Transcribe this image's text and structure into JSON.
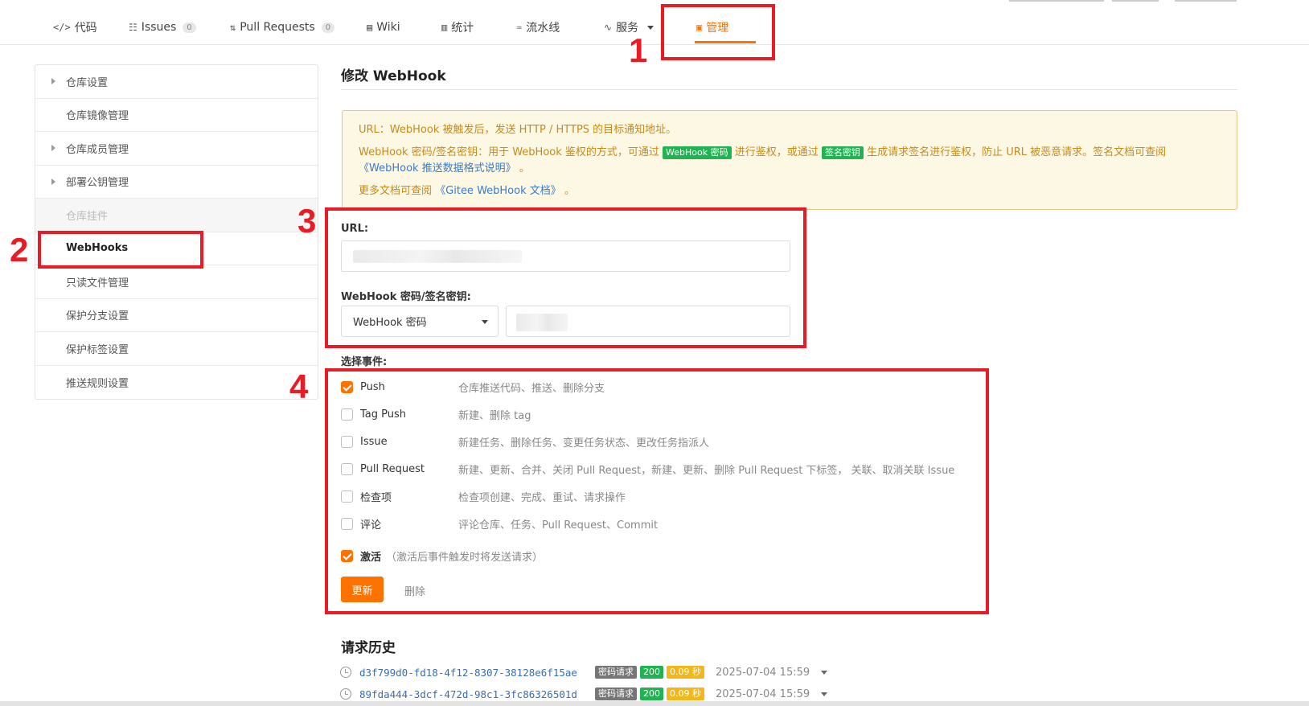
{
  "tabs": [
    {
      "icon": "</>",
      "label": "代码",
      "count": ""
    },
    {
      "icon": "☷",
      "label": "Issues",
      "count": "0"
    },
    {
      "icon": "⇅",
      "label": "Pull Requests",
      "count": "0"
    },
    {
      "icon": "▤",
      "label": "Wiki",
      "count": ""
    },
    {
      "icon": "▥",
      "label": "统计",
      "count": ""
    },
    {
      "icon": "♒",
      "label": "流水线",
      "count": ""
    },
    {
      "icon": "∿",
      "label": "服务",
      "count": ""
    },
    {
      "icon": "▣",
      "label": "管理",
      "count": ""
    }
  ],
  "sidebar": {
    "items": [
      {
        "label": "仓库设置"
      },
      {
        "label": "仓库镜像管理"
      },
      {
        "label": "仓库成员管理"
      },
      {
        "label": "部署公钥管理"
      },
      {
        "label": "仓库挂件"
      },
      {
        "label": "WebHooks"
      },
      {
        "label": "只读文件管理"
      },
      {
        "label": "保护分支设置"
      },
      {
        "label": "保护标签设置"
      },
      {
        "label": "推送规则设置"
      }
    ]
  },
  "page": {
    "title": "修改 WebHook"
  },
  "notice": {
    "line1": "URL：WebHook 被触发后，发送 HTTP / HTTPS 的目标通知地址。",
    "line2_a": "WebHook 密码/签名密钥：用于 WebHook 鉴权的方式，可通过",
    "tag_password": "WebHook 密码",
    "line2_b": "进行鉴权，或通过",
    "tag_sign": "签名密钥",
    "line2_c": "生成请求签名进行鉴权，防止 URL 被恶意请求。签名文档可查阅",
    "link_push_doc": "《WebHook 推送数据格式说明》",
    "line2_end": "。",
    "line3_a": "更多文档可查阅",
    "link_gitee_doc": "《Gitee WebHook 文档》",
    "line3_end": "。"
  },
  "form": {
    "url_label": "URL:",
    "secret_label": "WebHook 密码/签名密钥:",
    "secret_type": "WebHook 密码",
    "events_label": "选择事件:"
  },
  "events": [
    {
      "name": "Push",
      "desc": "仓库推送代码、推送、删除分支",
      "checked": true
    },
    {
      "name": "Tag Push",
      "desc": "新建、删除 tag",
      "checked": false
    },
    {
      "name": "Issue",
      "desc": "新建任务、删除任务、变更任务状态、更改任务指派人",
      "checked": false
    },
    {
      "name": "Pull Request",
      "desc": "新建、更新、合并、关闭 Pull Request，新建、更新、删除 Pull Request 下标签， 关联、取消关联 Issue",
      "checked": false
    },
    {
      "name": "检查项",
      "desc": "检查项创建、完成、重试、请求操作",
      "checked": false
    },
    {
      "name": "评论",
      "desc": "评论仓库、任务、Pull Request、Commit",
      "checked": false
    }
  ],
  "activate": {
    "label": "激活",
    "hint": "（激活后事件触发时将发送请求）",
    "checked": true
  },
  "buttons": {
    "update": "更新",
    "delete": "删除"
  },
  "history": {
    "title": "请求历史",
    "rows": [
      {
        "id": "d3f799d0-fd18-4f12-8307-38128e6f15ae",
        "type": "密码请求",
        "status": "200",
        "duration": "0.09 秒",
        "time": "2025-07-04 15:59"
      },
      {
        "id": "89fda444-3dcf-472d-98c1-3fc86326501d",
        "type": "密码请求",
        "status": "200",
        "duration": "0.09 秒",
        "time": "2025-07-04 15:59"
      }
    ]
  },
  "annotations": [
    "1",
    "2",
    "3",
    "4"
  ],
  "colors": {
    "accent": "#fe7300",
    "annotation": "#e81c24",
    "success": "#21b351",
    "warning": "#f3b71a"
  }
}
